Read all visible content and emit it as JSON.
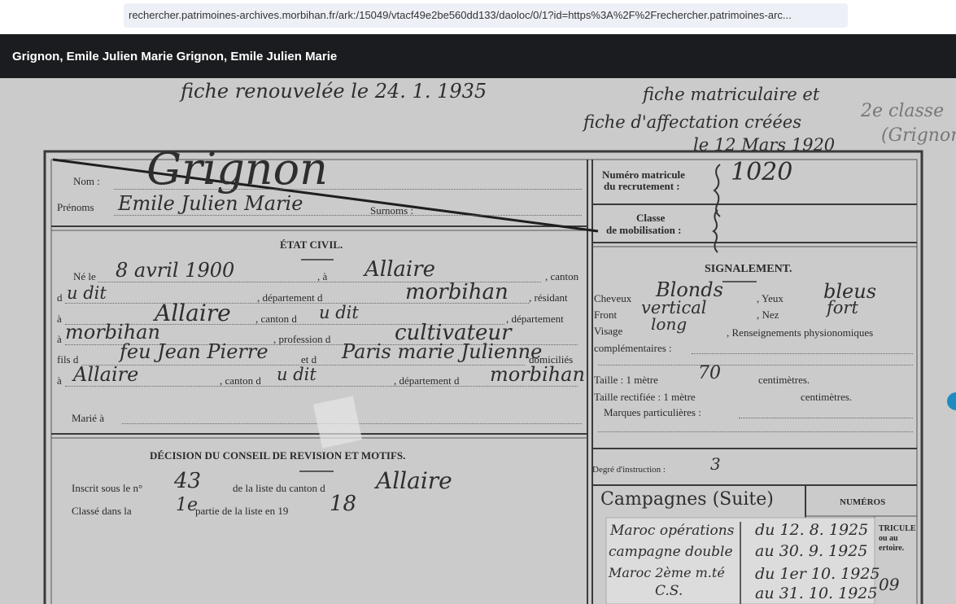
{
  "browser": {
    "url": "rechercher.patrimoines-archives.morbihan.fr/ark:/15049/vtacf49e2be560dd133/daoloc/0/1?id=https%3A%2F%2Frechercher.patrimoines-arc..."
  },
  "viewer": {
    "title": "Grignon, Emile Julien Marie Grignon, Emile Julien Marie"
  },
  "document": {
    "top_note": "fiche renouvelée le 24. 1. 1935",
    "top_right_note_1": "fiche matriculaire et",
    "top_right_note_2": "fiche d'affectation créées",
    "top_right_note_3": "le 12 Mars 1920",
    "corner_note_1": "2e classe",
    "corner_note_2": "(Grignon)",
    "nom_label": "Nom :",
    "nom_value": "Grignon",
    "prenoms_label": "Prénoms",
    "prenoms_value": "Emile Julien Marie",
    "surnoms_label": "Surnoms :",
    "matricule_label_1": "Numéro matricule",
    "matricule_label_2": "du recrutement :",
    "matricule_value": "1020",
    "classe_label_1": "Classe",
    "classe_label_2": "de mobilisation :",
    "etat_civil_heading": "ÉTAT CIVIL.",
    "ne_le_label": "Né le",
    "ne_le_value": "8 avril 1900",
    "a_label": ", à",
    "lieu_naissance": "Allaire",
    "canton_label": ", canton",
    "d_label": "d",
    "canton_value": "u dit",
    "departement_label": ", département d",
    "departement_value": "morbihan",
    "resident_label": ", résidant",
    "a2_label": "à",
    "residence_value": "Allaire",
    "canton2_label": ", canton d",
    "canton2_value": "u dit",
    "departement2_label": ", département",
    "a3_label": "à",
    "departement2_value": "morbihan",
    "profession_label": ", profession d",
    "profession_value": "cultivateur",
    "fils_label": "fils d",
    "pere_value": "feu Jean Pierre",
    "et_label": "et d",
    "mere_value": "Paris marie Julienne",
    "domicilies_label": "domiciliés",
    "a4_label": "à",
    "domicile_value": "Allaire",
    "canton3_label": ", canton d",
    "canton3_value": "u dit",
    "departement3_label": ", département d",
    "departement3_value": "morbihan",
    "marie_label": "Marié à",
    "decision_heading": "DÉCISION DU CONSEIL DE REVISION ET MOTIFS.",
    "inscrit_label": "Inscrit sous le n°",
    "inscrit_value": "43",
    "liste_label": "de la liste du canton d",
    "liste_value": "Allaire",
    "classe_dans_label": "Classé dans la",
    "classe_dans_value": "1e",
    "partie_label": "partie de la liste en 19",
    "annee_value": "18",
    "signalement_heading": "SIGNALEMENT.",
    "cheveux_label": "Cheveux",
    "cheveux_value": "Blonds",
    "yeux_label": ", Yeux",
    "yeux_value": "bleus",
    "front_label": "Front",
    "front_value": "vertical",
    "nez_label": ", Nez",
    "nez_value": "fort",
    "visage_label": "Visage",
    "visage_value": "long",
    "renseignements_label": ", Renseignements physionomiques",
    "complementaires_label": "complémentaires :",
    "taille_label": "Taille : 1 mètre",
    "taille_value": "70",
    "centimetres_label": "centimètres.",
    "taille_rectifiee_label": "Taille rectifiée : 1 mètre",
    "centimetres2_label": "centimètres.",
    "marques_label": "Marques particulières :",
    "degre_label": "Degré d'instruction :",
    "degre_value": "3",
    "campagnes_heading": "Campagnes (Suite)",
    "numeros_heading": "NUMÉROS",
    "numeros_sub_1": "TRICULE",
    "numeros_sub_2": "ou au",
    "numeros_sub_3": "ertoire.",
    "campagne_lines": [
      {
        "desc": "Maroc opérations",
        "date": "du 12. 8. 1925"
      },
      {
        "desc": "campagne double",
        "date": "au 30. 9. 1925"
      },
      {
        "desc": "Maroc 2ème m.té",
        "date": "du 1er 10. 1925"
      },
      {
        "desc": "C.S.",
        "date": "au 31. 10. 1925"
      }
    ],
    "side_number": "09"
  }
}
